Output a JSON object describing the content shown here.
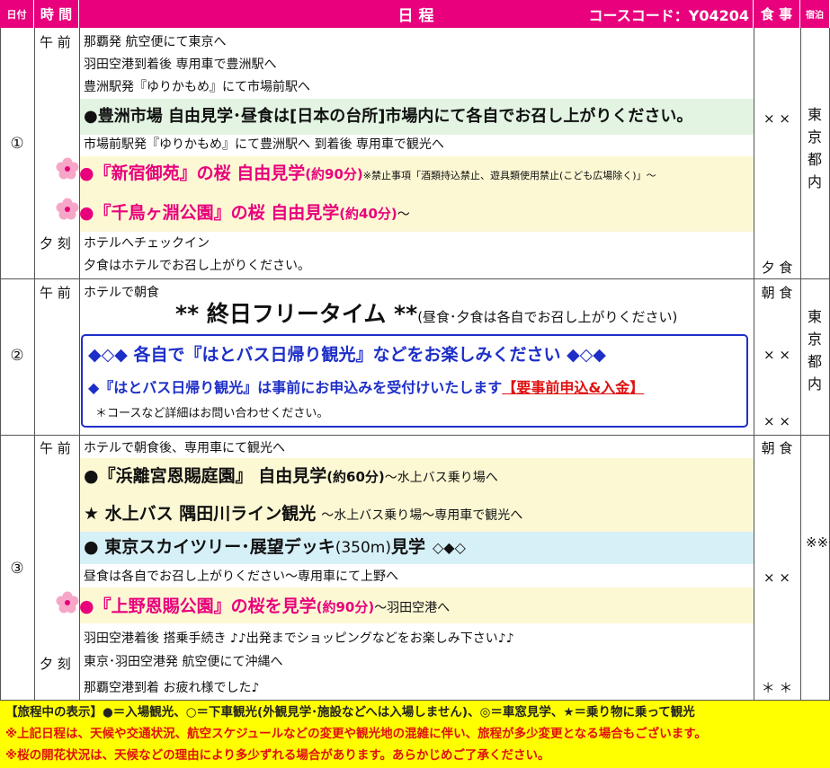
{
  "header": {
    "date": "日付",
    "time": "時 間",
    "schedule": "日 程",
    "course_code": "コースコード：Y04204",
    "meal": "食 事",
    "stay": "宿泊"
  },
  "day1": {
    "num": "①",
    "am": "午 前",
    "pm": "夕 刻",
    "l1": "那覇発 航空便にて東京へ",
    "l2": "羽田空港到着後 専用車で豊洲駅へ",
    "l3": "豊洲駅発『ゆりかもめ』にて市場前駅へ",
    "l4": "●豊洲市場 自由見学･昼食は[日本の台所]市場内にて各自でお召し上がりください。",
    "l5": "市場前駅発『ゆりかもめ』にて豊洲駅へ 到着後 専用車で観光へ",
    "l6_main": "●『新宿御苑』の桜 自由見学",
    "l6_dur": "(約90分)",
    "l6_note": "※禁止事項「酒類持込禁止、遊具類使用禁止(こども広場除く)」～",
    "l7_main": "●『千鳥ヶ淵公園』の桜 自由見学",
    "l7_dur": "(約40分)",
    "l7_tail": "～",
    "l8": "ホテルへチェックイン",
    "l9": "夕食はホテルでお召し上がりください。",
    "meal_lunch": "× ×",
    "meal_dinner": "夕 食",
    "stay": "東京都内"
  },
  "day2": {
    "num": "②",
    "am": "午 前",
    "l1": "ホテルで朝食",
    "free_main": "** 終日フリータイム **",
    "free_note": "(昼食･夕食は各自でお召し上がりください)",
    "box1": "◆◇◆ 各自で『はとバス日帰り観光』などをお楽しみください ◆◇◆",
    "box2": "◆『はとバス日帰り観光』は事前にお申込みを受付けいたします",
    "box2_red": "【要事前申込&入金】",
    "box3": "＊コースなど詳細はお問い合わせください。",
    "meal_breakfast": "朝 食",
    "meal_lunch": "× ×",
    "meal_dinner": "× ×",
    "stay": "東京都内"
  },
  "day3": {
    "num": "③",
    "am": "午 前",
    "pm": "夕 刻",
    "l1": "ホテルで朝食後、専用車にて観光へ",
    "l2_main": "●『浜離宮恩賜庭園』 自由見学",
    "l2_dur": "(約60分)",
    "l2_tail": "～水上バス乗り場へ",
    "l3_main": "★ 水上バス 隅田川ライン観光",
    "l3_tail": "～水上バス乗り場～専用車で観光へ",
    "l4_a": "● 東京スカイツリー･展望デッキ",
    "l4_b": "(350m)",
    "l4_c": "見学",
    "l4_d": "◇◆◇",
    "l5": "昼食は各自でお召し上がりください～専用車にて上野へ",
    "l6_main": "●『上野恩賜公園』の桜を見学",
    "l6_dur": "(約90分)",
    "l6_tail": "～羽田空港へ",
    "l7": "羽田空港着後 搭乗手続き ♪♪出発までショッピングなどをお楽しみ下さい♪♪",
    "l8": "東京･羽田空港発 航空便にて沖縄へ",
    "l9": "那覇空港到着 お疲れ様でした♪",
    "meal_breakfast": "朝 食",
    "meal_lunch": "× ×",
    "meal_dinner": "＊ ＊",
    "stay": "※※※"
  },
  "footer": {
    "legend": "【旅程中の表示】●＝入場観光、○＝下車観光(外観見学･施設などへは入場しません)、◎＝車窓見学、★＝乗り物に乗って観光",
    "note1": "※上記日程は、天候や交通状況、航空スケジュールなどの変更や観光地の混雑に伴い、旅程が多少変更となる場合もございます。",
    "note2": "※桜の開花状況は、天候などの理由により多少ずれる場合があります。あらかじめご了承ください。"
  },
  "colors": {
    "header": "#e8007c",
    "pink": "#e8007c",
    "blue": "#1e2fc8",
    "footer_bg": "#ffff00",
    "footer_text": "#e01010"
  },
  "icons": {
    "flower": "sakura-flower-icon"
  }
}
